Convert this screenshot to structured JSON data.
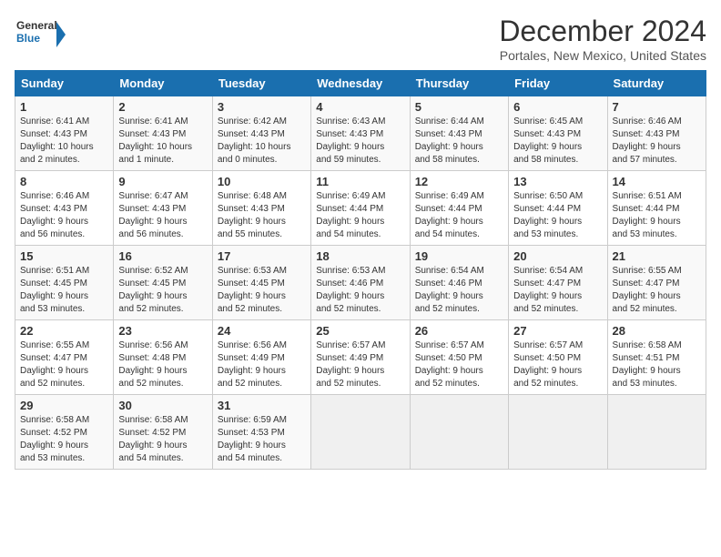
{
  "header": {
    "logo_line1": "General",
    "logo_line2": "Blue",
    "title": "December 2024",
    "subtitle": "Portales, New Mexico, United States"
  },
  "weekdays": [
    "Sunday",
    "Monday",
    "Tuesday",
    "Wednesday",
    "Thursday",
    "Friday",
    "Saturday"
  ],
  "weeks": [
    [
      {
        "day": "1",
        "info": "Sunrise: 6:41 AM\nSunset: 4:43 PM\nDaylight: 10 hours\nand 2 minutes."
      },
      {
        "day": "2",
        "info": "Sunrise: 6:41 AM\nSunset: 4:43 PM\nDaylight: 10 hours\nand 1 minute."
      },
      {
        "day": "3",
        "info": "Sunrise: 6:42 AM\nSunset: 4:43 PM\nDaylight: 10 hours\nand 0 minutes."
      },
      {
        "day": "4",
        "info": "Sunrise: 6:43 AM\nSunset: 4:43 PM\nDaylight: 9 hours\nand 59 minutes."
      },
      {
        "day": "5",
        "info": "Sunrise: 6:44 AM\nSunset: 4:43 PM\nDaylight: 9 hours\nand 58 minutes."
      },
      {
        "day": "6",
        "info": "Sunrise: 6:45 AM\nSunset: 4:43 PM\nDaylight: 9 hours\nand 58 minutes."
      },
      {
        "day": "7",
        "info": "Sunrise: 6:46 AM\nSunset: 4:43 PM\nDaylight: 9 hours\nand 57 minutes."
      }
    ],
    [
      {
        "day": "8",
        "info": "Sunrise: 6:46 AM\nSunset: 4:43 PM\nDaylight: 9 hours\nand 56 minutes."
      },
      {
        "day": "9",
        "info": "Sunrise: 6:47 AM\nSunset: 4:43 PM\nDaylight: 9 hours\nand 56 minutes."
      },
      {
        "day": "10",
        "info": "Sunrise: 6:48 AM\nSunset: 4:43 PM\nDaylight: 9 hours\nand 55 minutes."
      },
      {
        "day": "11",
        "info": "Sunrise: 6:49 AM\nSunset: 4:44 PM\nDaylight: 9 hours\nand 54 minutes."
      },
      {
        "day": "12",
        "info": "Sunrise: 6:49 AM\nSunset: 4:44 PM\nDaylight: 9 hours\nand 54 minutes."
      },
      {
        "day": "13",
        "info": "Sunrise: 6:50 AM\nSunset: 4:44 PM\nDaylight: 9 hours\nand 53 minutes."
      },
      {
        "day": "14",
        "info": "Sunrise: 6:51 AM\nSunset: 4:44 PM\nDaylight: 9 hours\nand 53 minutes."
      }
    ],
    [
      {
        "day": "15",
        "info": "Sunrise: 6:51 AM\nSunset: 4:45 PM\nDaylight: 9 hours\nand 53 minutes."
      },
      {
        "day": "16",
        "info": "Sunrise: 6:52 AM\nSunset: 4:45 PM\nDaylight: 9 hours\nand 52 minutes."
      },
      {
        "day": "17",
        "info": "Sunrise: 6:53 AM\nSunset: 4:45 PM\nDaylight: 9 hours\nand 52 minutes."
      },
      {
        "day": "18",
        "info": "Sunrise: 6:53 AM\nSunset: 4:46 PM\nDaylight: 9 hours\nand 52 minutes."
      },
      {
        "day": "19",
        "info": "Sunrise: 6:54 AM\nSunset: 4:46 PM\nDaylight: 9 hours\nand 52 minutes."
      },
      {
        "day": "20",
        "info": "Sunrise: 6:54 AM\nSunset: 4:47 PM\nDaylight: 9 hours\nand 52 minutes."
      },
      {
        "day": "21",
        "info": "Sunrise: 6:55 AM\nSunset: 4:47 PM\nDaylight: 9 hours\nand 52 minutes."
      }
    ],
    [
      {
        "day": "22",
        "info": "Sunrise: 6:55 AM\nSunset: 4:47 PM\nDaylight: 9 hours\nand 52 minutes."
      },
      {
        "day": "23",
        "info": "Sunrise: 6:56 AM\nSunset: 4:48 PM\nDaylight: 9 hours\nand 52 minutes."
      },
      {
        "day": "24",
        "info": "Sunrise: 6:56 AM\nSunset: 4:49 PM\nDaylight: 9 hours\nand 52 minutes."
      },
      {
        "day": "25",
        "info": "Sunrise: 6:57 AM\nSunset: 4:49 PM\nDaylight: 9 hours\nand 52 minutes."
      },
      {
        "day": "26",
        "info": "Sunrise: 6:57 AM\nSunset: 4:50 PM\nDaylight: 9 hours\nand 52 minutes."
      },
      {
        "day": "27",
        "info": "Sunrise: 6:57 AM\nSunset: 4:50 PM\nDaylight: 9 hours\nand 52 minutes."
      },
      {
        "day": "28",
        "info": "Sunrise: 6:58 AM\nSunset: 4:51 PM\nDaylight: 9 hours\nand 53 minutes."
      }
    ],
    [
      {
        "day": "29",
        "info": "Sunrise: 6:58 AM\nSunset: 4:52 PM\nDaylight: 9 hours\nand 53 minutes."
      },
      {
        "day": "30",
        "info": "Sunrise: 6:58 AM\nSunset: 4:52 PM\nDaylight: 9 hours\nand 54 minutes."
      },
      {
        "day": "31",
        "info": "Sunrise: 6:59 AM\nSunset: 4:53 PM\nDaylight: 9 hours\nand 54 minutes."
      },
      {
        "day": "",
        "info": ""
      },
      {
        "day": "",
        "info": ""
      },
      {
        "day": "",
        "info": ""
      },
      {
        "day": "",
        "info": ""
      }
    ]
  ]
}
